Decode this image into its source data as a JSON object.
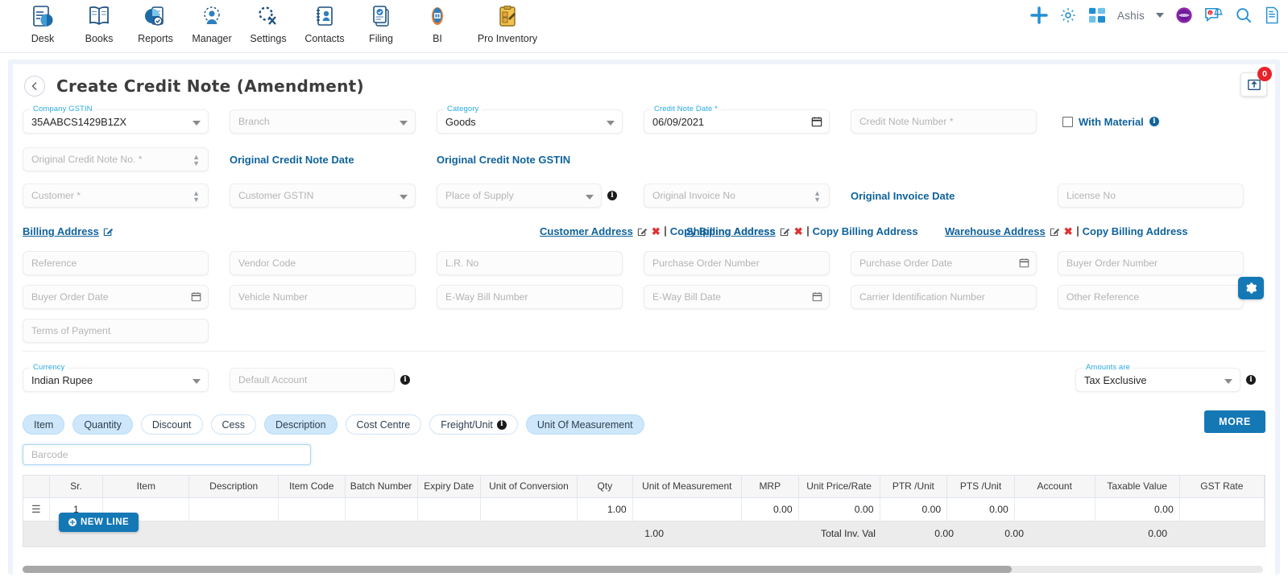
{
  "nav": {
    "apps": [
      {
        "label": "Desk",
        "icon": "desk-icon"
      },
      {
        "label": "Books",
        "icon": "books-icon"
      },
      {
        "label": "Reports",
        "icon": "reports-icon"
      },
      {
        "label": "Manager",
        "icon": "manager-icon"
      },
      {
        "label": "Settings",
        "icon": "settings-icon"
      },
      {
        "label": "Contacts",
        "icon": "contacts-icon"
      },
      {
        "label": "Filing",
        "icon": "filing-icon"
      },
      {
        "label": "BI",
        "icon": "bi-icon"
      },
      {
        "label": "Pro Inventory",
        "icon": "pro-inventory-icon"
      }
    ],
    "user": "Ashis",
    "notification_count": "0"
  },
  "page": {
    "title": "Create Credit Note (Amendment)",
    "upload_badge": "0"
  },
  "form": {
    "company_gstin": {
      "label": "Company GSTIN",
      "value": "35AABCS1429B1ZX"
    },
    "branch": {
      "placeholder": "Branch"
    },
    "category": {
      "label": "Category",
      "value": "Goods"
    },
    "credit_note_date": {
      "label": "Credit Note Date *",
      "value": "06/09/2021"
    },
    "credit_note_number": {
      "placeholder": "Credit Note Number *"
    },
    "with_material": {
      "label": "With Material"
    },
    "original_credit_note_no": {
      "placeholder": "Original Credit Note No. *"
    },
    "original_credit_note_date": {
      "label": "Original Credit Note Date"
    },
    "original_credit_note_gstin": {
      "label": "Original Credit Note GSTIN"
    },
    "customer": {
      "placeholder": "Customer *"
    },
    "customer_gstin": {
      "placeholder": "Customer GSTIN"
    },
    "place_of_supply": {
      "placeholder": "Place of Supply"
    },
    "original_invoice_no": {
      "placeholder": "Original Invoice No"
    },
    "original_invoice_date": {
      "label": "Original Invoice Date"
    },
    "license_no": {
      "placeholder": "License No"
    },
    "addresses": [
      {
        "link": "Billing Address",
        "has_delete": false,
        "has_copy": false,
        "copy_label": ""
      },
      {
        "link": "Customer Address",
        "has_delete": true,
        "has_copy": true,
        "copy_label": "Copy Billing Address"
      },
      {
        "link": "Shipping Address",
        "has_delete": true,
        "has_copy": true,
        "copy_label": "Copy Billing Address"
      },
      {
        "link": "Warehouse Address",
        "has_delete": true,
        "has_copy": true,
        "copy_label": "Copy Billing Address"
      }
    ],
    "reference": {
      "placeholder": "Reference"
    },
    "vendor_code": {
      "placeholder": "Vendor Code"
    },
    "lr_no": {
      "placeholder": "L.R. No"
    },
    "purchase_order_number": {
      "placeholder": "Purchase Order Number"
    },
    "purchase_order_date": {
      "placeholder": "Purchase Order Date"
    },
    "buyer_order_number": {
      "placeholder": "Buyer Order Number"
    },
    "buyer_order_date": {
      "placeholder": "Buyer Order Date"
    },
    "vehicle_number": {
      "placeholder": "Vehicle Number"
    },
    "eway_bill_number": {
      "placeholder": "E-Way Bill Number"
    },
    "eway_bill_date": {
      "placeholder": "E-Way Bill Date"
    },
    "carrier_identification_number": {
      "placeholder": "Carrier Identification Number"
    },
    "other_reference": {
      "placeholder": "Other Reference"
    },
    "terms_of_payment": {
      "placeholder": "Terms of Payment"
    },
    "currency": {
      "label": "Currency",
      "value": "Indian Rupee"
    },
    "default_account": {
      "placeholder": "Default Account"
    },
    "amounts_are": {
      "label": "Amounts are",
      "value": "Tax Exclusive"
    }
  },
  "chips": [
    {
      "label": "Item",
      "selected": true,
      "info": false
    },
    {
      "label": "Quantity",
      "selected": true,
      "info": false
    },
    {
      "label": "Discount",
      "selected": false,
      "info": false
    },
    {
      "label": "Cess",
      "selected": false,
      "info": false
    },
    {
      "label": "Description",
      "selected": true,
      "info": false
    },
    {
      "label": "Cost Centre",
      "selected": false,
      "info": false
    },
    {
      "label": "Freight/Unit",
      "selected": false,
      "info": true
    },
    {
      "label": "Unit Of Measurement",
      "selected": true,
      "info": false
    }
  ],
  "more_button": "MORE",
  "barcode": {
    "placeholder": "Barcode"
  },
  "grid": {
    "columns": [
      "",
      "Sr.",
      "Item",
      "Description",
      "Item Code",
      "Batch Number",
      "Expiry Date",
      "Unit of Conversion",
      "Qty",
      "Unit of Measurement",
      "MRP",
      "Unit Price/Rate",
      "PTR /Unit",
      "PTS /Unit",
      "Account",
      "Taxable Value",
      "GST Rate"
    ],
    "rows": [
      {
        "handle": "drag-handle-icon",
        "sr": "1",
        "item": "",
        "description": "",
        "item_code": "",
        "batch_number": "",
        "expiry_date": "",
        "unit_of_conversion": "",
        "qty": "1.00",
        "unit_of_measurement": "",
        "mrp": "0.00",
        "unit_price_rate": "0.00",
        "ptr_unit": "0.00",
        "pts_unit": "0.00",
        "account": "",
        "taxable_value": "0.00",
        "gst_rate": ""
      }
    ],
    "new_line_button": "NEW LINE",
    "footer": {
      "qty": "1.00",
      "total_label": "Total Inv. Val",
      "ptr_unit": "0.00",
      "pts_unit": "0.00",
      "taxable_value": "0.00"
    }
  }
}
